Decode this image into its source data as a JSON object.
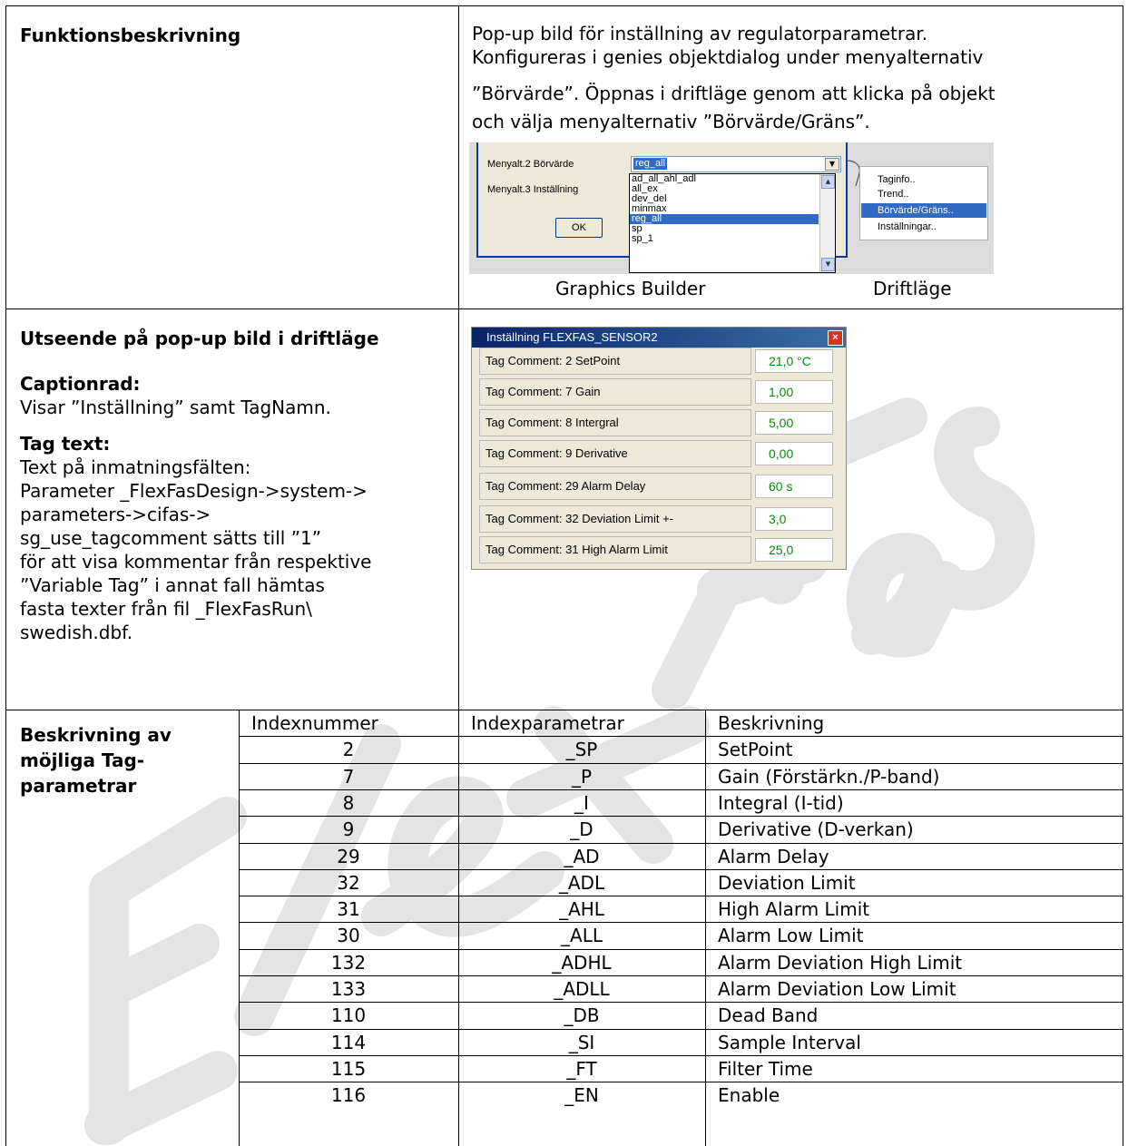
{
  "section1": {
    "heading": "Funktionsbeskrivning",
    "desc_lines": [
      "Pop-up bild för inställning av regulatorparametrar.",
      "Konfigureras i genies objektdialog under menyalternativ",
      "”Börvärde”. Öppnas i driftläge genom att klicka på objekt",
      "och välja menyalternativ ”Börvärde/Gräns”."
    ],
    "caption_builder": "Graphics Builder",
    "caption_driftlage": "Driftläge",
    "builder": {
      "label_menyalt2": "Menyalt.2 Börvärde",
      "label_menyalt3": "Menyalt.3 Inställning",
      "combo_value": "reg_all",
      "list_items": [
        "ad_all_ahl_adl",
        "all_ex",
        "dev_del",
        "minmax",
        "reg_all",
        "sp",
        "sp_1"
      ],
      "selected_item": "reg_all",
      "ok_label": "OK",
      "menu_items": [
        "Taginfo..",
        "Trend..",
        "Börvärde/Gräns..",
        "Inställningar.."
      ],
      "menu_selected": "Börvärde/Gräns.."
    }
  },
  "section2": {
    "heading": "Utseende på pop-up bild i driftläge",
    "caption_heading": "Captionrad:",
    "caption_text": "Visar ”Inställning” samt TagNamn.",
    "tagtext_heading": "Tag text:",
    "tagtext_lines": [
      "Text på inmatningsfälten:",
      "Parameter _FlexFasDesign->system->",
      "parameters->cifas->",
      "sg_use_tagcomment sätts till ”1”",
      "för att visa kommentar från respektive",
      "”Variable Tag” i annat fall hämtas",
      "fasta texter från fil _FlexFasRun\\",
      "swedish.dbf."
    ],
    "popup": {
      "title": "Inställning FLEXFAS_SENSOR2",
      "rows": [
        {
          "label": "Tag Comment: 2 SetPoint",
          "value": "21,0 °C"
        },
        {
          "label": "Tag Comment: 7 Gain",
          "value": "1,00"
        },
        {
          "label": "Tag Comment: 8 Intergral",
          "value": "5,00"
        },
        {
          "label": "Tag Comment: 9 Derivative",
          "value": "0,00"
        },
        {
          "label": "Tag Comment: 29 Alarm Delay",
          "value": "60 s"
        },
        {
          "label": "Tag Comment: 32 Deviation Limit +-",
          "value": "3,0"
        },
        {
          "label": "Tag Comment: 31 High Alarm Limit",
          "value": "25,0"
        }
      ]
    }
  },
  "section3": {
    "heading_lines": [
      "Beskrivning av",
      "möjliga Tag-",
      "parametrar"
    ],
    "columns": [
      "Indexnummer",
      "Indexparametrar",
      "Beskrivning"
    ],
    "rows": [
      [
        "2",
        "_SP",
        "SetPoint"
      ],
      [
        "7",
        "_P",
        "Gain (Förstärkn./P-band)"
      ],
      [
        "8",
        "_I",
        "Integral (I-tid)"
      ],
      [
        "9",
        "_D",
        "Derivative (D-verkan)"
      ],
      [
        "29",
        "_AD",
        "Alarm Delay"
      ],
      [
        "32",
        "_ADL",
        "Deviation Limit"
      ],
      [
        "31",
        "_AHL",
        "High Alarm Limit"
      ],
      [
        "30",
        "_ALL",
        "Alarm Low Limit"
      ],
      [
        "132",
        "_ADHL",
        "Alarm Deviation High Limit"
      ],
      [
        "133",
        "_ADLL",
        "Alarm Deviation Low Limit"
      ],
      [
        "110",
        "_DB",
        "Dead Band"
      ],
      [
        "114",
        "_SI",
        "Sample Interval"
      ],
      [
        "115",
        "_FT",
        "Filter Time"
      ],
      [
        "116",
        "_EN",
        "Enable"
      ]
    ]
  },
  "colors": {
    "watermark": "#e6e6e6",
    "title_bar": "#0a246a",
    "value_green": "#0a8a0a",
    "selection": "#316ac5"
  }
}
